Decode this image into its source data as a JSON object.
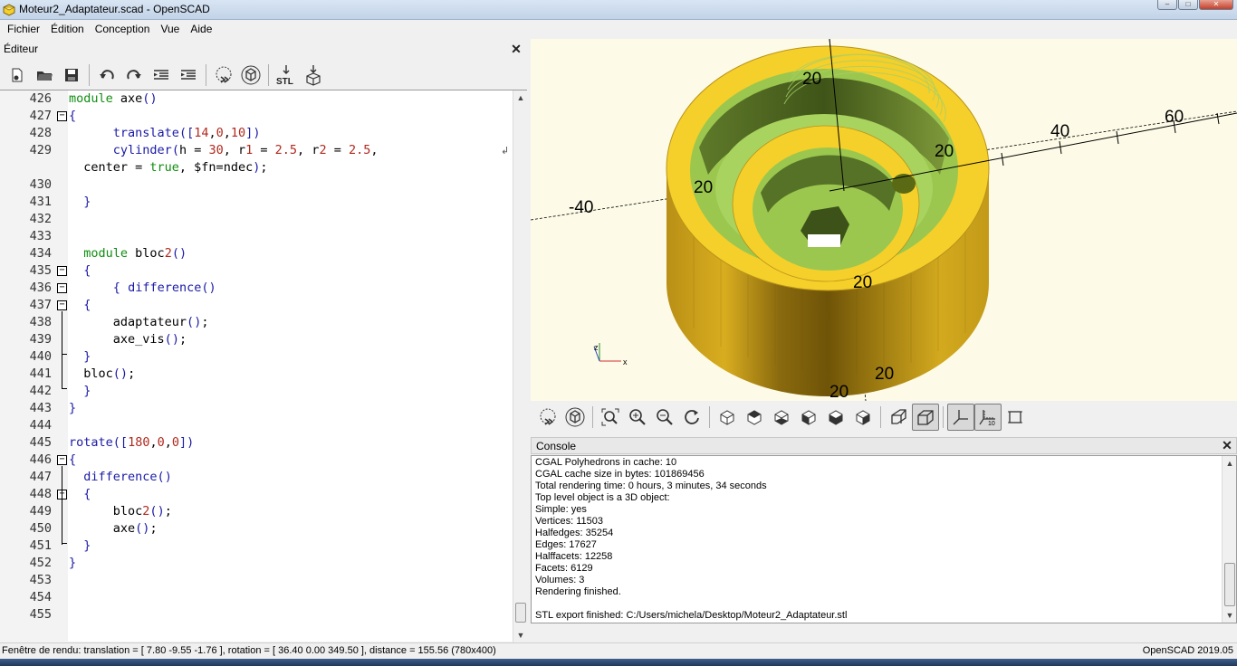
{
  "window": {
    "title": "Moteur2_Adaptateur.scad - OpenSCAD",
    "controls": [
      "–",
      "□",
      "✕"
    ]
  },
  "menu": [
    "Fichier",
    "Édition",
    "Conception",
    "Vue",
    "Aide"
  ],
  "editor": {
    "title": "Éditeur",
    "close": "✕",
    "toolbar": [
      "new-file-icon",
      "open-file-icon",
      "save-icon",
      "undo-icon",
      "redo-icon",
      "unindent-icon",
      "indent-icon",
      "preview-icon",
      "render-icon",
      "export-stl-icon",
      "send-to-print-icon"
    ],
    "lines": [
      {
        "n": "426",
        "t": "module axe()"
      },
      {
        "n": "427",
        "t": "{"
      },
      {
        "n": "428",
        "t": "      translate([14,0,10])"
      },
      {
        "n": "429",
        "t": "      cylinder(h = 30, r1 = 2.5, r2 = 2.5,"
      },
      {
        "n": "",
        "t": "  center = true, $fn=ndec);"
      },
      {
        "n": "430",
        "t": ""
      },
      {
        "n": "431",
        "t": "  }"
      },
      {
        "n": "432",
        "t": ""
      },
      {
        "n": "433",
        "t": ""
      },
      {
        "n": "434",
        "t": "  module bloc2()"
      },
      {
        "n": "435",
        "t": "  {"
      },
      {
        "n": "436",
        "t": "      { difference()"
      },
      {
        "n": "437",
        "t": "  {"
      },
      {
        "n": "438",
        "t": "      adaptateur();"
      },
      {
        "n": "439",
        "t": "      axe_vis();"
      },
      {
        "n": "440",
        "t": "  }"
      },
      {
        "n": "441",
        "t": "  bloc();"
      },
      {
        "n": "442",
        "t": "  }"
      },
      {
        "n": "443",
        "t": "}"
      },
      {
        "n": "444",
        "t": ""
      },
      {
        "n": "445",
        "t": "rotate([180,0,0])"
      },
      {
        "n": "446",
        "t": "{"
      },
      {
        "n": "447",
        "t": "  difference()"
      },
      {
        "n": "448",
        "t": "  {"
      },
      {
        "n": "449",
        "t": "      bloc2();"
      },
      {
        "n": "450",
        "t": "      axe();"
      },
      {
        "n": "451",
        "t": "  }"
      },
      {
        "n": "452",
        "t": "}"
      },
      {
        "n": "453",
        "t": ""
      },
      {
        "n": "454",
        "t": ""
      },
      {
        "n": "455",
        "t": ""
      }
    ]
  },
  "viewport": {
    "axis_labels": [
      "-40",
      "20",
      "40",
      "60",
      "20",
      "20",
      "20",
      "20",
      "20"
    ],
    "colors": {
      "background": "#fdfbe7",
      "model": "#f5cf2a",
      "inner": "#a4d45c"
    }
  },
  "view_toolbar": [
    "preview-icon",
    "render-icon",
    "view-all-icon",
    "zoom-in-icon",
    "zoom-out-icon",
    "reset-view-icon",
    "view-right-icon",
    "view-top-icon",
    "view-bottom-icon",
    "view-left-icon",
    "view-front-icon",
    "view-back-icon",
    "perspective-icon",
    "orthogonal-icon",
    "show-axes-icon",
    "show-scale-markers-icon",
    "show-edges-icon"
  ],
  "console": {
    "title": "Console",
    "close": "✕",
    "lines": [
      "CGAL Polyhedrons in cache: 10",
      "CGAL cache size in bytes: 101869456",
      "Total rendering time: 0 hours, 3 minutes, 34 seconds",
      "Top level object is a 3D object:",
      "Simple: yes",
      "Vertices: 11503",
      "Halfedges: 35254",
      "Edges: 17627",
      "Halffacets: 12258",
      "Facets: 6129",
      "Volumes: 3",
      "Rendering finished.",
      "",
      "STL export finished: C:/Users/michela/Desktop/Moteur2_Adaptateur.stl"
    ]
  },
  "status": {
    "left": "Fenêtre de rendu: translation = [ 7.80 -9.55 -1.76 ], rotation = [ 36.40 0.00 349.50 ], distance = 155.56 (780x400)",
    "right": "OpenSCAD 2019.05"
  }
}
